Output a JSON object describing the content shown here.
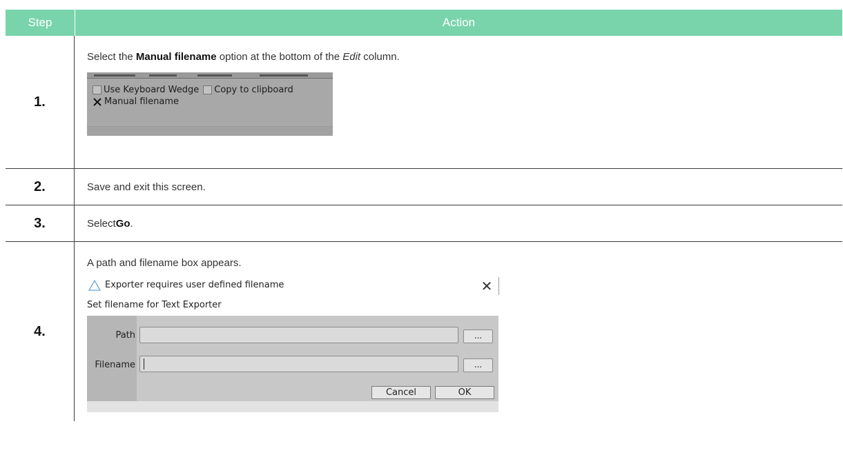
{
  "header": {
    "step": "Step",
    "action": "Action"
  },
  "rows": [
    {
      "step": "1.",
      "text_before": "Select the ",
      "keyword": "Manual filename",
      "text_middle": " option at the bottom of the ",
      "emphasis": "Edit",
      "text_after": " column.",
      "screenshot": {
        "checkbox_keyboard_wedge": {
          "label": "Use Keyboard Wedge",
          "checked": false
        },
        "checkbox_copy_clipboard": {
          "label": "Copy to clipboard",
          "checked": false
        },
        "checkbox_manual_filename": {
          "label": "Manual filename",
          "checked": true
        }
      }
    },
    {
      "step": "2.",
      "text": "Save and exit this screen."
    },
    {
      "step": "3.",
      "text_before": "Select ",
      "keyword": "Go",
      "text_after": "."
    },
    {
      "step": "4.",
      "text": "A path and filename box appears.",
      "dialog": {
        "title": "Exporter requires user defined filename",
        "subtitle": "Set filename for Text Exporter",
        "path_label": "Path",
        "filename_label": "Filename",
        "browse_label": "...",
        "cancel_label": "Cancel",
        "ok_label": "OK",
        "close_glyph": "✕",
        "icon": "triangle-app-icon"
      }
    }
  ],
  "colors": {
    "header_bg": "#79d4ab",
    "header_text": "#ffffff"
  }
}
